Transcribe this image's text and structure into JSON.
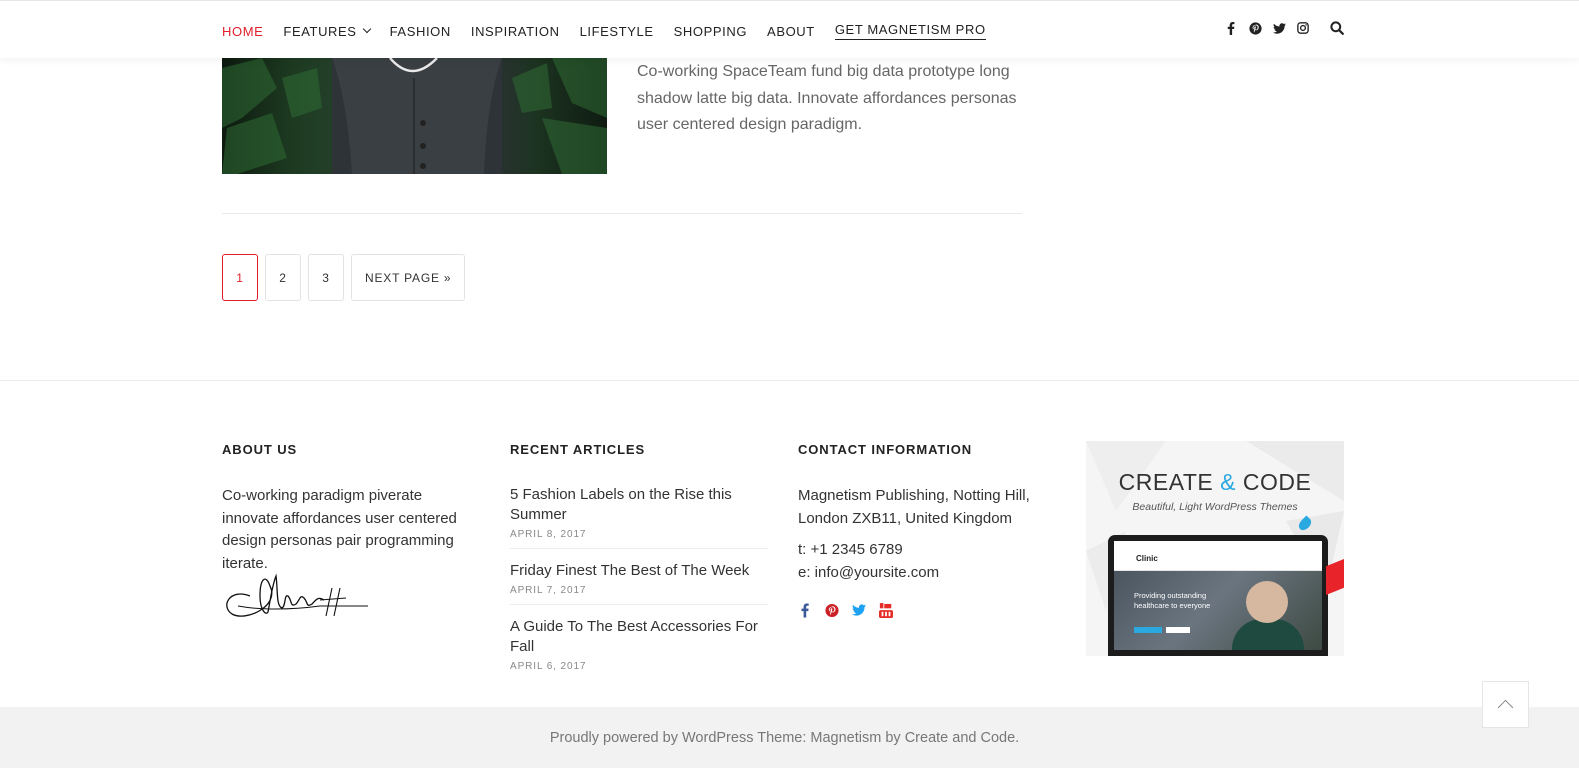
{
  "nav": {
    "items": [
      {
        "label": "HOME",
        "active": true
      },
      {
        "label": "FEATURES",
        "dropdown": true
      },
      {
        "label": "FASHION"
      },
      {
        "label": "INSPIRATION"
      },
      {
        "label": "LIFESTYLE"
      },
      {
        "label": "SHOPPING"
      },
      {
        "label": "ABOUT"
      },
      {
        "label": "GET MAGNETISM PRO"
      }
    ],
    "social_icons": [
      "facebook-icon",
      "pinterest-icon",
      "twitter-icon",
      "instagram-icon"
    ],
    "search_icon": "search-icon"
  },
  "post": {
    "excerpt": "Co-working SpaceTeam fund big data prototype long shadow latte big data. Innovate affordances personas user centered design paradigm."
  },
  "pagination": {
    "pages": [
      "1",
      "2",
      "3"
    ],
    "current": "1",
    "next_label": "NEXT PAGE »"
  },
  "footer": {
    "about": {
      "title": "ABOUT US",
      "text": "Co-working paradigm piverate innovate affordances user centered design personas pair programming iterate."
    },
    "recent": {
      "title": "RECENT ARTICLES",
      "articles": [
        {
          "title": "5 Fashion Labels on the Rise this Summer",
          "date": "APRIL 8, 2017"
        },
        {
          "title": "Friday Finest The Best of The Week",
          "date": "APRIL 7, 2017"
        },
        {
          "title": "A Guide To The Best Accessories For Fall",
          "date": "APRIL 6, 2017"
        }
      ]
    },
    "contact": {
      "title": "CONTACT INFORMATION",
      "address": "Magnetism Publishing, Notting Hill, London ZXB11, United Kingdom",
      "phone": "t: +1 2345 6789",
      "email": "e: info@yoursite.com",
      "social_icons": [
        "facebook-icon",
        "pinterest-icon",
        "twitter-icon",
        "youtube-icon"
      ]
    },
    "ad": {
      "title_left": "CREATE ",
      "title_amp": "&",
      "title_right": " CODE",
      "subtitle": "Beautiful, Light WordPress Themes",
      "screen_brand": "Clinic",
      "screen_headline": "Providing outstanding healthcare to everyone"
    },
    "credit_text": "Proudly powered by WordPress Theme: ",
    "credit_link1": "Magnetism",
    "credit_mid": " by ",
    "credit_link2": "Create and Code",
    "credit_end": "."
  },
  "colors": {
    "accent": "#e01f2b",
    "facebook": "#3b5998",
    "pinterest": "#cb2027",
    "twitter": "#1da1f2",
    "youtube": "#e52d27"
  }
}
